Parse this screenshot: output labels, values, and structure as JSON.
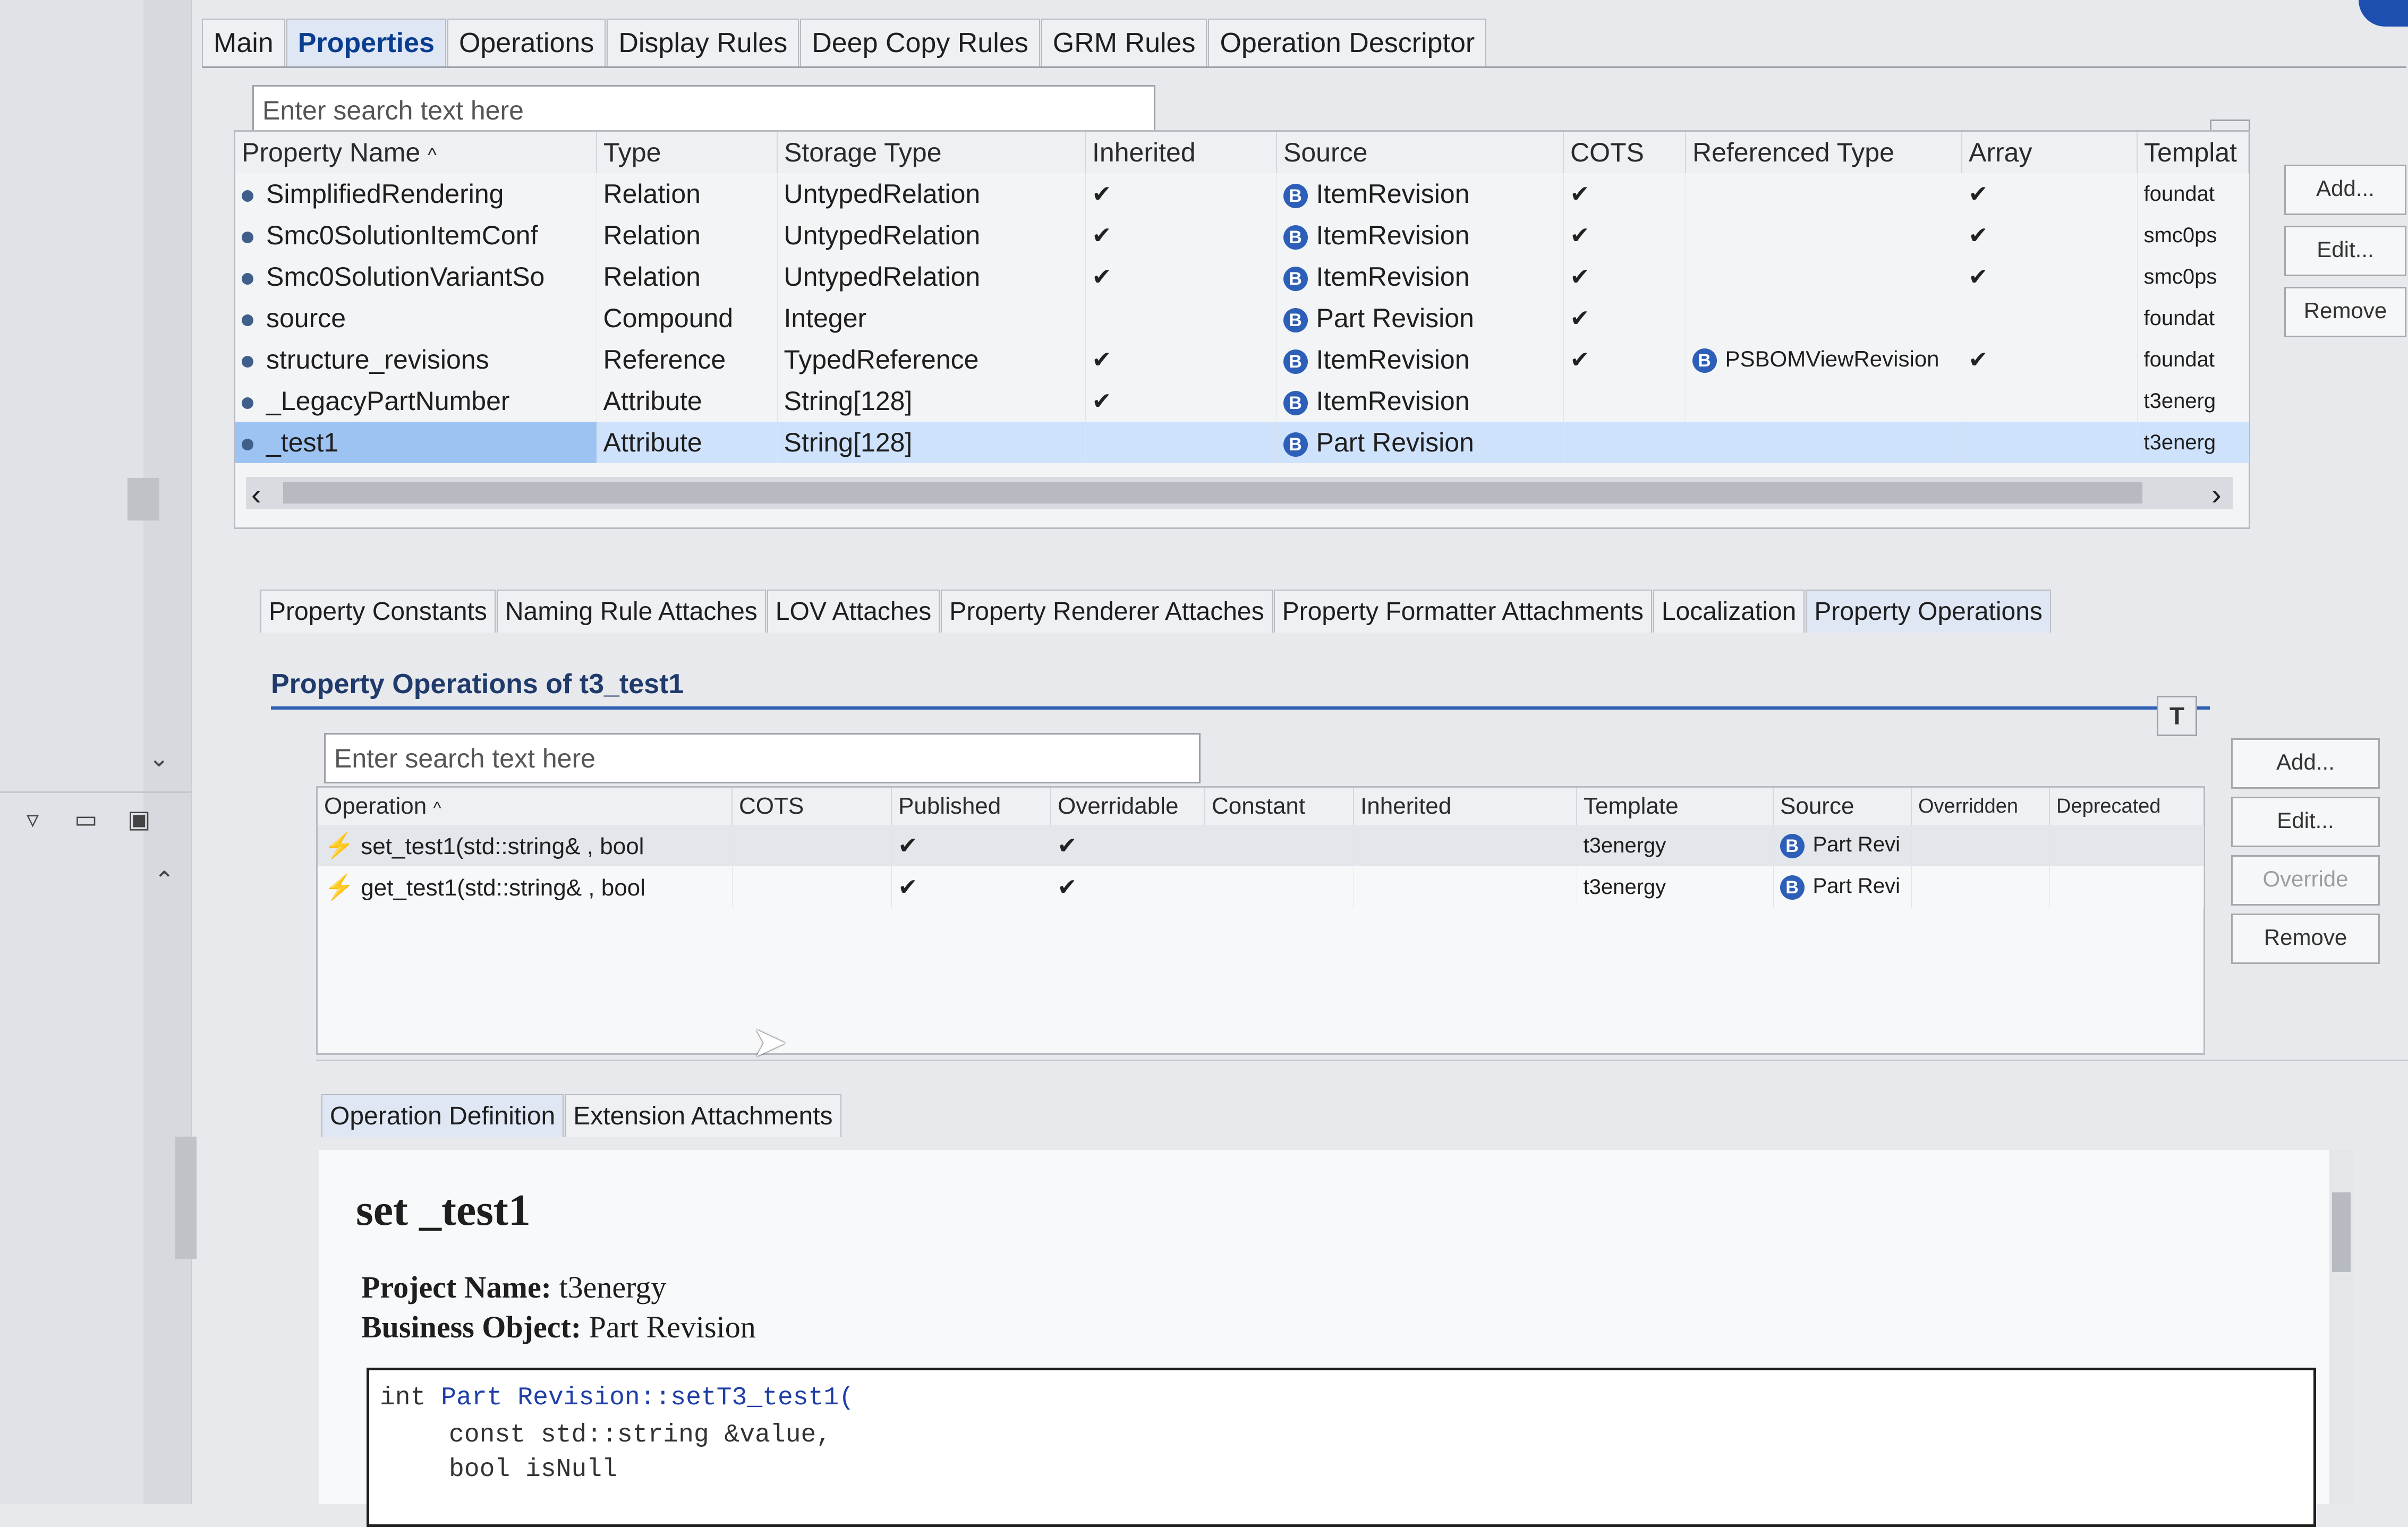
{
  "main_tabs": [
    {
      "label": "Main"
    },
    {
      "label": "Properties"
    },
    {
      "label": "Operations"
    },
    {
      "label": "Display Rules"
    },
    {
      "label": "Deep Copy Rules"
    },
    {
      "label": "GRM Rules"
    },
    {
      "label": "Operation Descriptor"
    }
  ],
  "properties": {
    "search_placeholder": "Enter search text here",
    "columns": [
      "Property Name",
      "Type",
      "Storage Type",
      "Inherited",
      "Source",
      "COTS",
      "Referenced Type",
      "Array",
      "Templat"
    ],
    "rows": [
      {
        "name": "SimplifiedRendering",
        "type": "Relation",
        "storage": "UntypedRelation",
        "inherited": "✔",
        "source": "ItemRevision",
        "cots": "✔",
        "ref": "",
        "array": "✔",
        "template": "foundat"
      },
      {
        "name": "Smc0SolutionItemConf",
        "type": "Relation",
        "storage": "UntypedRelation",
        "inherited": "✔",
        "source": "ItemRevision",
        "cots": "✔",
        "ref": "",
        "array": "✔",
        "template": "smc0ps"
      },
      {
        "name": "Smc0SolutionVariantSo",
        "type": "Relation",
        "storage": "UntypedRelation",
        "inherited": "✔",
        "source": "ItemRevision",
        "cots": "✔",
        "ref": "",
        "array": "✔",
        "template": "smc0ps"
      },
      {
        "name": "source",
        "type": "Compound",
        "storage": "Integer",
        "inherited": "",
        "source": "Part Revision",
        "cots": "✔",
        "ref": "",
        "array": "",
        "template": "foundat"
      },
      {
        "name": "structure_revisions",
        "type": "Reference",
        "storage": "TypedReference",
        "inherited": "✔",
        "source": "ItemRevision",
        "cots": "✔",
        "ref": "PSBOMViewRevision",
        "array": "✔",
        "template": "foundat"
      },
      {
        "name": "_LegacyPartNumber",
        "type": "Attribute",
        "storage": "String[128]",
        "inherited": "✔",
        "source": "ItemRevision",
        "cots": "",
        "ref": "",
        "array": "",
        "template": "t3energ"
      },
      {
        "name": "_test1",
        "type": "Attribute",
        "storage": "String[128]",
        "inherited": "",
        "source": "Part Revision",
        "cots": "",
        "ref": "",
        "array": "",
        "template": "t3energ"
      }
    ],
    "buttons": {
      "add": "Add...",
      "edit": "Edit...",
      "remove": "Remove"
    }
  },
  "sub_tabs": [
    {
      "label": "Property Constants"
    },
    {
      "label": "Naming Rule Attaches"
    },
    {
      "label": "LOV Attaches"
    },
    {
      "label": "Property Renderer Attaches"
    },
    {
      "label": "Property Formatter Attachments"
    },
    {
      "label": "Localization"
    },
    {
      "label": "Property Operations"
    }
  ],
  "operations": {
    "title": "Property Operations of t3_test1",
    "search_placeholder": "Enter search text here",
    "columns": [
      "Operation",
      "COTS",
      "Published",
      "Overridable",
      "Constant",
      "Inherited",
      "Template",
      "Source",
      "Overridden",
      "Deprecated"
    ],
    "rows": [
      {
        "operation": "set_test1(std::string& , bool",
        "cots": "",
        "published": "✔",
        "overridable": "✔",
        "constant": "",
        "inherited": "",
        "template": "t3energy",
        "source": "Part Revi",
        "overridden": "",
        "deprecated": ""
      },
      {
        "operation": "get_test1(std::string& , bool",
        "cots": "",
        "published": "✔",
        "overridable": "✔",
        "constant": "",
        "inherited": "",
        "template": "t3energy",
        "source": "Part Revi",
        "overridden": "",
        "deprecated": ""
      }
    ],
    "buttons": {
      "add": "Add...",
      "edit": "Edit...",
      "override": "Override",
      "remove": "Remove"
    }
  },
  "detail_tabs": [
    {
      "label": "Operation Definition"
    },
    {
      "label": "Extension Attachments"
    }
  ],
  "definition": {
    "heading": "set _test1",
    "project_label": "Project Name:",
    "project_value": "t3energy",
    "bo_label": "Business Object:",
    "bo_value": "Part Revision",
    "code_line1_ret": "int",
    "code_line1_sig": "Part Revision::setT3_test1(",
    "code_line2": "const std::string &value,",
    "code_line3": "bool isNull"
  },
  "icons": {
    "business_object": "B",
    "sort_up": "^",
    "filter": "T",
    "scroll_left": "‹",
    "scroll_right": "›"
  }
}
